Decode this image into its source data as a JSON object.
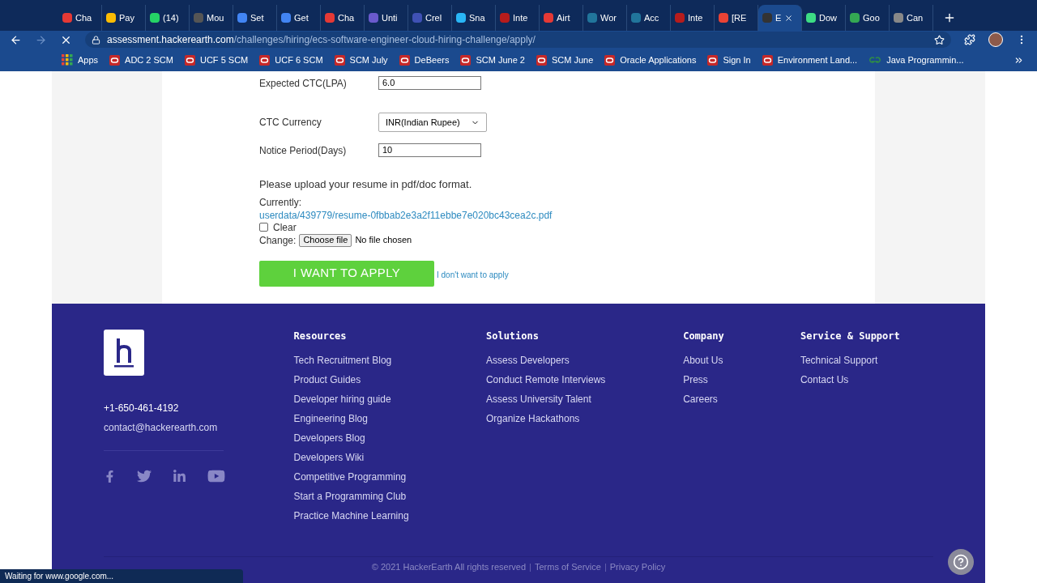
{
  "tabs": [
    {
      "label": "Cha",
      "color": "#e53935",
      "selected": false
    },
    {
      "label": "Pay",
      "color": "#fbbc04",
      "selected": false
    },
    {
      "label": "(14)",
      "color": "#25d366",
      "selected": false
    },
    {
      "label": "Mou",
      "color": "#555555",
      "selected": false
    },
    {
      "label": "Set",
      "color": "#4285f4",
      "selected": false
    },
    {
      "label": "Get",
      "color": "#4285f4",
      "selected": false
    },
    {
      "label": "Cha",
      "color": "#e53935",
      "selected": false
    },
    {
      "label": "Unti",
      "color": "#6a5acd",
      "selected": false
    },
    {
      "label": "Crel",
      "color": "#3f51b5",
      "selected": false
    },
    {
      "label": "Sna",
      "color": "#29b6f6",
      "selected": false
    },
    {
      "label": "Inte",
      "color": "#b71c1c",
      "selected": false
    },
    {
      "label": "Airt",
      "color": "#e53935",
      "selected": false
    },
    {
      "label": "Wor",
      "color": "#21759b",
      "selected": false
    },
    {
      "label": "Acc",
      "color": "#21759b",
      "selected": false
    },
    {
      "label": "Inte",
      "color": "#b71c1c",
      "selected": false
    },
    {
      "label": "[RE",
      "color": "#ea4335",
      "selected": false
    },
    {
      "label": "E",
      "color": "#333333",
      "selected": true
    },
    {
      "label": "Dow",
      "color": "#3ddc84",
      "selected": false
    },
    {
      "label": "Goo",
      "color": "#34a853",
      "selected": false
    },
    {
      "label": "Can",
      "color": "#888888",
      "selected": false
    }
  ],
  "address": {
    "host": "assessment.hackerearth.com",
    "path": "/challenges/hiring/ecs-software-engineer-cloud-hiring-challenge/apply/"
  },
  "bookmarks": [
    {
      "label": "Apps",
      "kind": "apps"
    },
    {
      "label": "ADC 2 SCM",
      "kind": "oracle"
    },
    {
      "label": "UCF 5 SCM",
      "kind": "oracle"
    },
    {
      "label": "UCF 6 SCM",
      "kind": "oracle"
    },
    {
      "label": "SCM July",
      "kind": "oracle"
    },
    {
      "label": "DeBeers",
      "kind": "oracle"
    },
    {
      "label": "SCM June 2",
      "kind": "oracle"
    },
    {
      "label": "SCM June",
      "kind": "oracle"
    },
    {
      "label": "Oracle Applications",
      "kind": "oracle"
    },
    {
      "label": "Sign In",
      "kind": "oracle"
    },
    {
      "label": "Environment Land...",
      "kind": "oracle"
    },
    {
      "label": "Java Programmin...",
      "kind": "gfg"
    }
  ],
  "form": {
    "fields": [
      {
        "label": "Expected CTC(LPA)",
        "kind": "text",
        "value": "6.0"
      },
      {
        "label": "CTC Currency",
        "kind": "select",
        "value": "INR(Indian Rupee)"
      },
      {
        "label": "Notice Period(Days)",
        "kind": "text",
        "value": "10"
      }
    ],
    "upload_prompt": "Please upload your resume in pdf/doc format.",
    "currently_label": "Currently:",
    "current_file": "userdata/439779/resume-0fbbab2e3a2f11ebbe7e020bc43cea2c.pdf",
    "clear": {
      "label": "Clear",
      "checked": false
    },
    "change_label": "Change:",
    "choose_button": "Choose file",
    "no_file": "No file chosen",
    "apply_button": "I WANT TO APPLY",
    "decline_link": "I don't want to apply"
  },
  "footer": {
    "phone": "+1-650-461-4192",
    "email": "contact@hackerearth.com",
    "columns": [
      {
        "heading": "Resources",
        "links": [
          "Tech Recruitment Blog",
          "Product Guides",
          "Developer hiring guide",
          "Engineering Blog",
          "Developers Blog",
          "Developers Wiki",
          "Competitive Programming",
          "Start a Programming Club",
          "Practice Machine Learning"
        ]
      },
      {
        "heading": "Solutions",
        "links": [
          "Assess Developers",
          "Conduct Remote Interviews",
          "Assess University Talent",
          "Organize Hackathons"
        ]
      },
      {
        "heading": "Company",
        "links": [
          "About Us",
          "Press",
          "Careers"
        ]
      },
      {
        "heading": "Service & Support",
        "links": [
          "Technical Support",
          "Contact Us"
        ]
      }
    ],
    "copyright": "© 2021 HackerEarth All rights reserved",
    "legal_links": [
      "Terms of Service",
      "Privacy Policy"
    ],
    "separator": "|"
  },
  "status_bar": "Waiting for www.google.com..."
}
